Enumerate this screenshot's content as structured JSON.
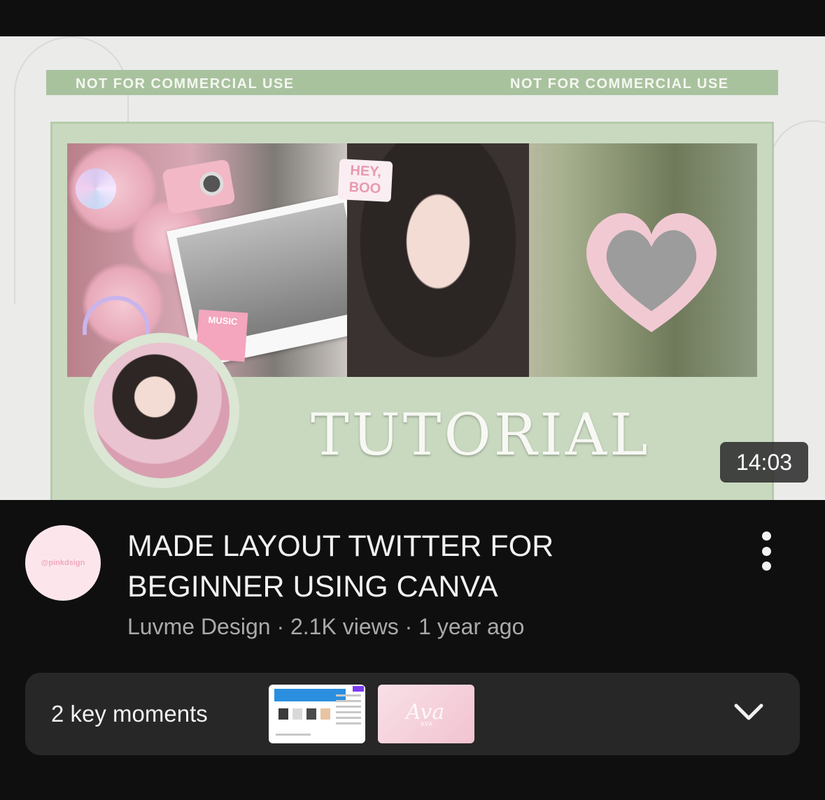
{
  "video": {
    "thumbnail": {
      "banner_left": "NOT FOR COMMERCIAL USE",
      "banner_right": "NOT FOR COMMERCIAL USE",
      "overlay_text": "TUTORIAL",
      "sticker_hey": "HEY, BOO",
      "sticker_music": "MUSIC",
      "duration": "14:03"
    },
    "title": "MADE LAYOUT TWITTER FOR BEGINNER USING CANVA",
    "channel_avatar_text": "@pinkdsign",
    "channel": "Luvme Design",
    "views": "2.1K views",
    "age": "1 year ago",
    "separator": "·"
  },
  "key_moments": {
    "label": "2 key moments",
    "thumb2_text": "AVA"
  },
  "icons": {
    "more": "more-vertical-icon",
    "expand": "chevron-down-icon"
  },
  "colors": {
    "background": "#0f0f0f",
    "panel_green": "#c9d9c0",
    "moments_bg": "#272727",
    "secondary_text": "#aaaaaa"
  }
}
